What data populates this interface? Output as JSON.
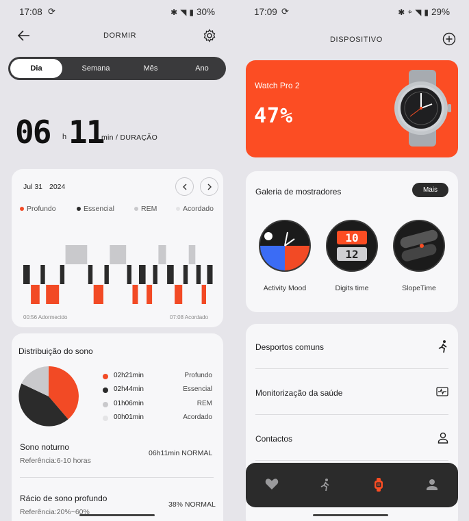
{
  "left": {
    "status": {
      "time": "17:08",
      "battery": "30%"
    },
    "title": "DORMIR",
    "tabs": [
      {
        "label": "Dia",
        "active": true
      },
      {
        "label": "Semana",
        "active": false
      },
      {
        "label": "Mês",
        "active": false
      },
      {
        "label": "Ano",
        "active": false
      }
    ],
    "duration": {
      "hours": "06",
      "h_unit": "h",
      "minutes": "11",
      "suffix": "min / DURAÇÃO"
    },
    "chart": {
      "date_day": "Jul 31",
      "date_year": "2024",
      "legend": [
        "Profundo",
        "Essencial",
        "REM",
        "Acordado"
      ],
      "start_label": "00:56 Adormecido",
      "end_label": "07:08 Acordado"
    },
    "distribution": {
      "title": "Distribuição do sono",
      "rows": [
        {
          "value": "02h21min",
          "name": "Profundo"
        },
        {
          "value": "02h44min",
          "name": "Essencial"
        },
        {
          "value": "01h06min",
          "name": "REM"
        },
        {
          "value": "00h01min",
          "name": "Acordado"
        }
      ],
      "night": {
        "title": "Sono noturno",
        "ref": "Referência:6-10 horas",
        "value": "06h11min NORMAL"
      },
      "deep": {
        "title": "Rácio de sono profundo",
        "ref": "Referência:20%~60%",
        "value": "38% NORMAL"
      }
    }
  },
  "right": {
    "status": {
      "time": "17:09",
      "battery": "29%"
    },
    "title": "DISPOSITIVO",
    "device": {
      "name": "Watch Pro 2",
      "battery": "47%"
    },
    "gallery": {
      "title": "Galeria de mostradores",
      "more": "Mais",
      "faces": [
        "Activity Mood",
        "Digits time",
        "SlopeTime"
      ]
    },
    "menu": [
      "Desportos comuns",
      "Monitorização da saúde",
      "Contactos"
    ]
  },
  "colors": {
    "deep": "#f24a25",
    "core": "#2b2b2b",
    "rem": "#c9c9cc",
    "awake": "#e4e4e6",
    "accent": "#fc4d23"
  },
  "chart_data": {
    "type": "bar",
    "categories": [
      "Profundo",
      "Essencial",
      "REM",
      "Acordado"
    ],
    "values_minutes": [
      141,
      164,
      66,
      1
    ],
    "stages_timeline": [
      "Essencial",
      "Profundo",
      "Essencial",
      "Profundo",
      "Essencial",
      "REM",
      "Essencial",
      "Profundo",
      "Essencial",
      "REM",
      "Essencial",
      "Profundo",
      "Essencial",
      "Profundo",
      "Essencial",
      "REM",
      "Essencial",
      "Profundo",
      "Essencial",
      "REM",
      "Essencial",
      "Profundo",
      "Essencial"
    ]
  }
}
